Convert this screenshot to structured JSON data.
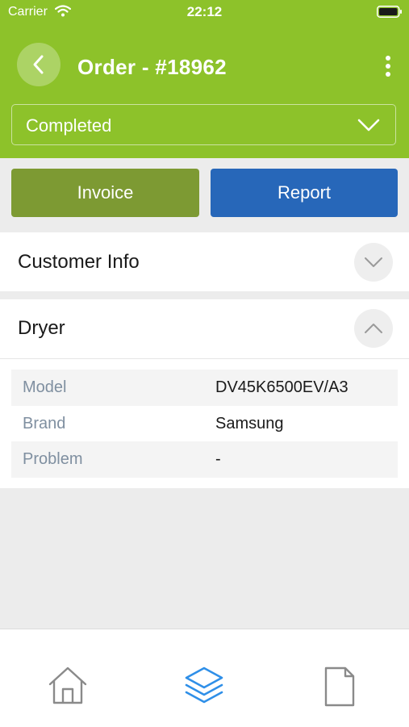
{
  "status_bar": {
    "carrier": "Carrier",
    "time": "22:12"
  },
  "header": {
    "title": "Order - #18962",
    "background_color": "#8dc22a",
    "back_icon": "chevron-left-icon",
    "more_icon": "more-vertical-icon"
  },
  "order_status": {
    "selected": "Completed",
    "icon": "chevron-down-icon"
  },
  "actions": {
    "invoice_label": "Invoice",
    "invoice_color": "#7d9a33",
    "report_label": "Report",
    "report_color": "#2767b9"
  },
  "sections": {
    "customer_info": {
      "title": "Customer Info",
      "expanded": false
    },
    "dryer": {
      "title": "Dryer",
      "expanded": true,
      "rows": [
        {
          "label": "Model",
          "value": "DV45K6500EV/A3"
        },
        {
          "label": "Brand",
          "value": "Samsung"
        },
        {
          "label": "Problem",
          "value": "-"
        }
      ]
    }
  },
  "tabbar": {
    "tabs": [
      {
        "name": "home",
        "icon": "home-icon",
        "active": false
      },
      {
        "name": "orders",
        "icon": "layers-icon",
        "active": true
      },
      {
        "name": "documents",
        "icon": "document-icon",
        "active": false
      }
    ],
    "active_color": "#2f8fe8",
    "inactive_color": "#8a8a8a"
  }
}
